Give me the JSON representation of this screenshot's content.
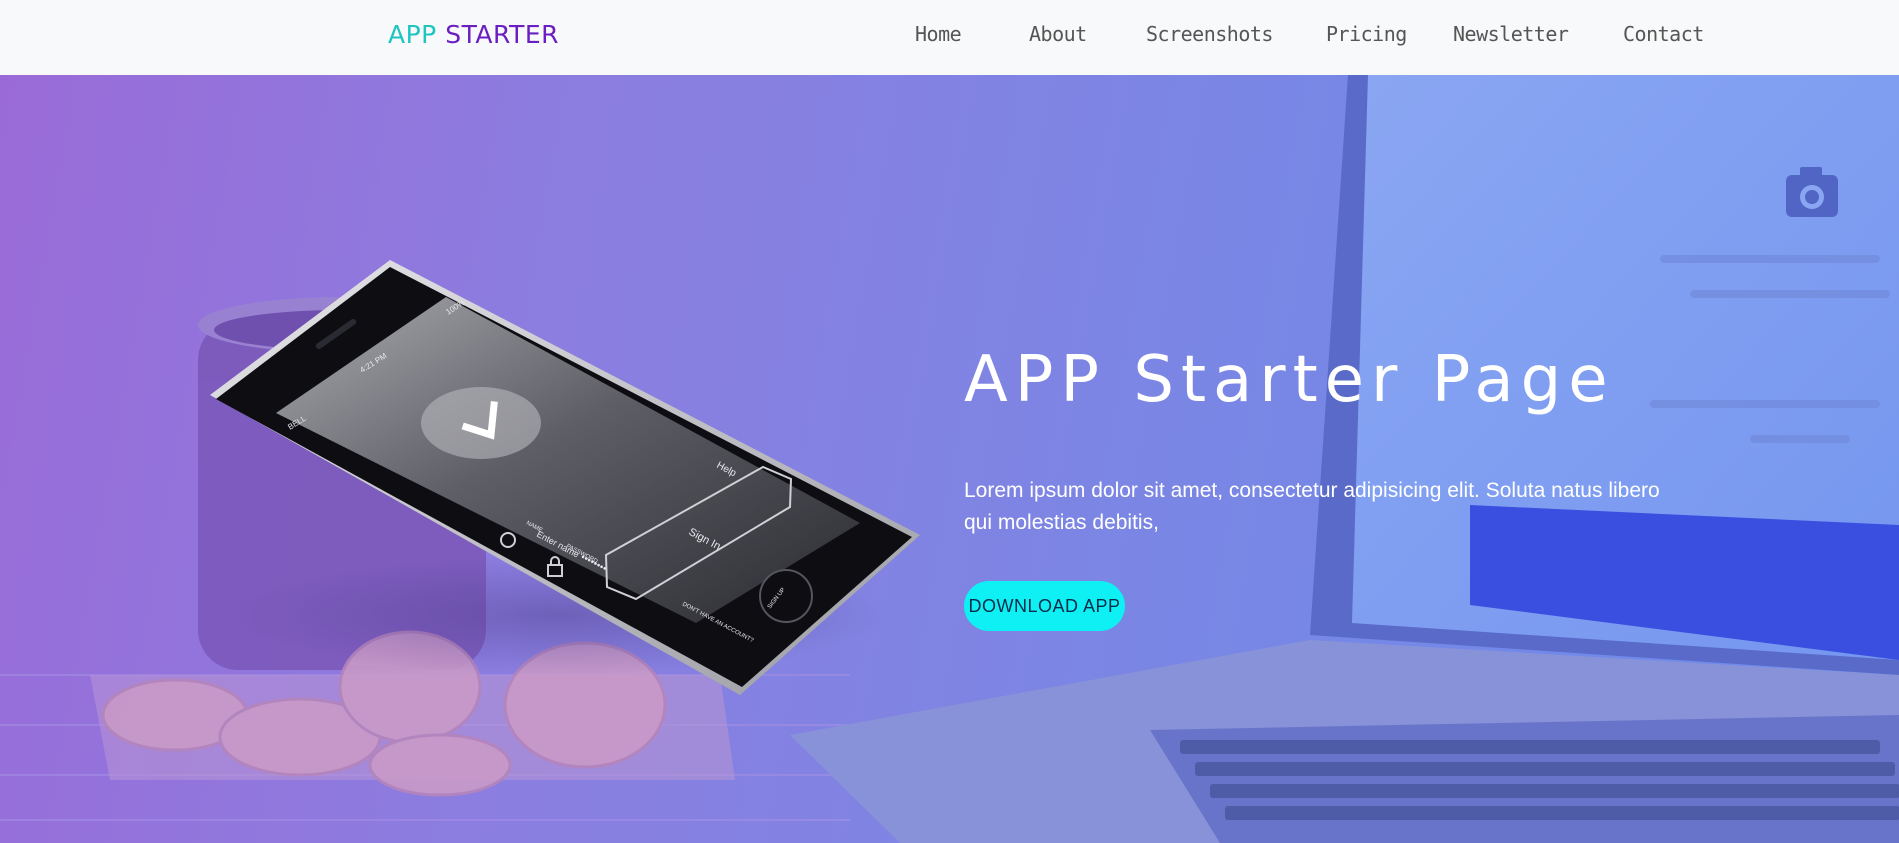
{
  "brand": {
    "part1": "APP",
    "part2": "STARTER"
  },
  "nav": {
    "items": [
      {
        "label": "Home"
      },
      {
        "label": "About"
      },
      {
        "label": "Screenshots"
      },
      {
        "label": "Pricing"
      },
      {
        "label": "Newsletter"
      },
      {
        "label": "Contact"
      }
    ]
  },
  "hero": {
    "title": "APP Starter Page",
    "description": "Lorem ipsum dolor sit amet, consectetur adipisicing elit. Soluta natus libero qui molestias debitis,",
    "button_label": "DOWNLOAD APP"
  },
  "phone": {
    "status_carrier": "BELL",
    "status_time": "4:21 PM",
    "status_battery": "100%",
    "help_label": "Help",
    "name_label": "NAME",
    "name_placeholder": "Enter name",
    "password_label": "PASSWORD",
    "password_value": "••••••••",
    "signin_label": "Sign In",
    "signup_prompt": "DON'T HAVE AN ACCOUNT?",
    "signup_link": "SIGN UP"
  },
  "colors": {
    "brand_primary": "#1ec5c0",
    "brand_secondary": "#6a1fc0",
    "cta_background": "#0ef0f4",
    "hero_gradient_start": "#9a6bd8",
    "hero_gradient_end": "#6a8cee"
  },
  "icons": [
    "camera-icon",
    "checkmark-icon",
    "user-icon",
    "lock-icon"
  ]
}
